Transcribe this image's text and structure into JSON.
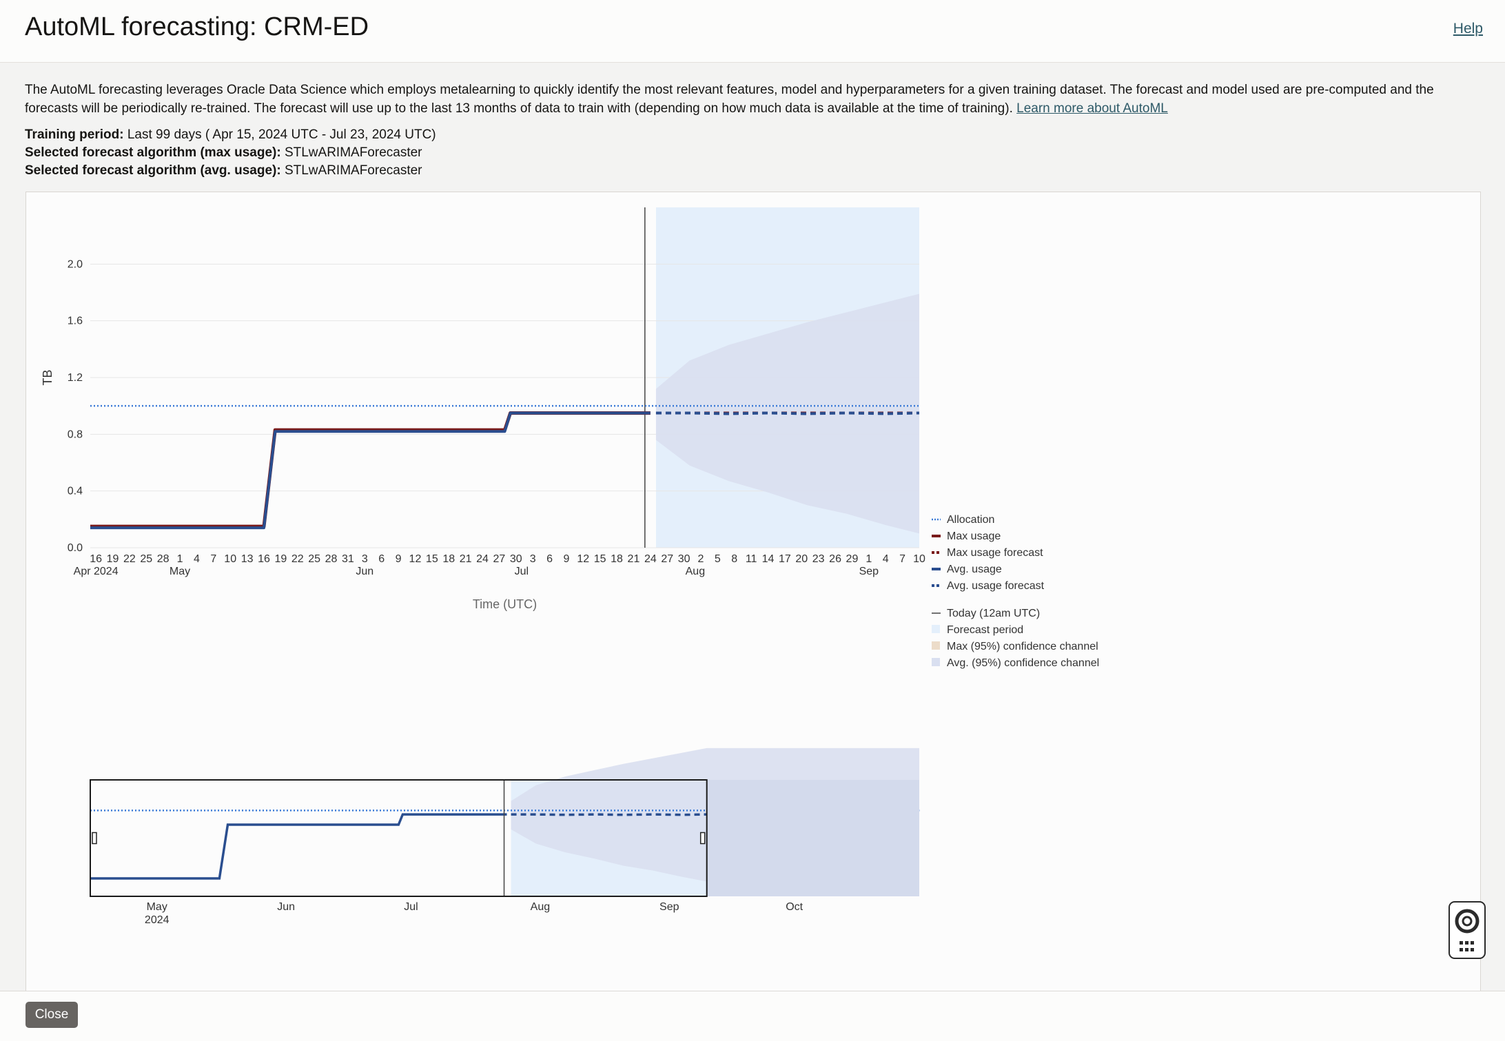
{
  "header": {
    "title": "AutoML forecasting: CRM-ED",
    "help_label": "Help"
  },
  "intro": {
    "description": "The AutoML forecasting leverages Oracle Data Science which employs metalearning to quickly identify the most relevant features, model and hyperparameters for a given training dataset. The forecast and model used are pre-computed and the forecasts will be periodically re-trained. The forecast will use up to the last 13 months of data to train with (depending on how much data is available at the time of training).",
    "learn_more": "Learn more about AutoML"
  },
  "details": {
    "training_label": "Training period:",
    "training_value": "Last 99 days ( Apr 15, 2024 UTC - Jul 23, 2024 UTC)",
    "max_algo_label": "Selected forecast algorithm (max usage):",
    "max_algo_value": "STLwARIMAForecaster",
    "avg_algo_label": "Selected forecast algorithm (avg. usage):",
    "avg_algo_value": "STLwARIMAForecaster"
  },
  "footer": {
    "close_label": "Close"
  },
  "colors": {
    "allocation": "#3a7ad6",
    "max_usage": "#7a1a1a",
    "avg_usage": "#2a4e8f",
    "forecast_period": "#e4effb",
    "max_confidence": "#ecdcc9",
    "avg_confidence": "#d9dff0",
    "today_line": "#444444",
    "navigator_selection": "#1a1a1a"
  },
  "chart_data": {
    "type": "line",
    "ylabel": "TB",
    "xlabel": "Time (UTC)",
    "ylim": [
      0,
      2.4
    ],
    "yticks": [
      "0.0",
      "0.4",
      "0.8",
      "1.2",
      "1.6",
      "2.0"
    ],
    "grid": true,
    "legend_position": "right",
    "x_tick_labels": [
      "16",
      "19",
      "22",
      "25",
      "28",
      "1",
      "4",
      "7",
      "10",
      "13",
      "16",
      "19",
      "22",
      "25",
      "28",
      "31",
      "3",
      "6",
      "9",
      "12",
      "15",
      "18",
      "21",
      "24",
      "27",
      "30",
      "3",
      "6",
      "9",
      "12",
      "15",
      "18",
      "21",
      "24",
      "27",
      "30",
      "2",
      "5",
      "8",
      "11",
      "14",
      "17",
      "20",
      "23",
      "26",
      "29",
      "1",
      "4",
      "7",
      "10"
    ],
    "x_tick_dates": [
      "2024-04-16",
      "2024-04-19",
      "2024-04-22",
      "2024-04-25",
      "2024-04-28",
      "2024-05-01",
      "2024-05-04",
      "2024-05-07",
      "2024-05-10",
      "2024-05-13",
      "2024-05-16",
      "2024-05-19",
      "2024-05-22",
      "2024-05-25",
      "2024-05-28",
      "2024-05-31",
      "2024-06-03",
      "2024-06-06",
      "2024-06-09",
      "2024-06-12",
      "2024-06-15",
      "2024-06-18",
      "2024-06-21",
      "2024-06-24",
      "2024-06-27",
      "2024-06-30",
      "2024-07-03",
      "2024-07-06",
      "2024-07-09",
      "2024-07-12",
      "2024-07-15",
      "2024-07-18",
      "2024-07-21",
      "2024-07-24",
      "2024-07-27",
      "2024-07-30",
      "2024-08-02",
      "2024-08-05",
      "2024-08-08",
      "2024-08-11",
      "2024-08-14",
      "2024-08-17",
      "2024-08-20",
      "2024-08-23",
      "2024-08-26",
      "2024-08-29",
      "2024-09-01",
      "2024-09-04",
      "2024-09-07",
      "2024-09-10"
    ],
    "month_labels": [
      {
        "date": "2024-04-16",
        "label": "Apr 2024"
      },
      {
        "date": "2024-05-01",
        "label": "May"
      },
      {
        "date": "2024-06-03",
        "label": "Jun"
      },
      {
        "date": "2024-07-01",
        "label": "Jul"
      },
      {
        "date": "2024-08-01",
        "label": "Aug"
      },
      {
        "date": "2024-09-01",
        "label": "Sep"
      }
    ],
    "x_range": [
      "2024-04-15",
      "2024-09-10"
    ],
    "today": "2024-07-24",
    "forecast_period": [
      "2024-07-25",
      "2024-09-10"
    ],
    "series": [
      {
        "name": "Allocation",
        "style": "dotted",
        "x": [
          "2024-04-15",
          "2024-09-10"
        ],
        "y": [
          1.0,
          1.0
        ]
      },
      {
        "name": "Max usage",
        "style": "solid",
        "x": [
          "2024-04-15",
          "2024-05-16",
          "2024-05-18",
          "2024-06-28",
          "2024-06-29",
          "2024-07-24"
        ],
        "y": [
          0.15,
          0.15,
          0.83,
          0.83,
          0.95,
          0.95
        ]
      },
      {
        "name": "Max usage forecast",
        "style": "dashed",
        "x": [
          "2024-07-25",
          "2024-09-10"
        ],
        "y": [
          0.95,
          0.95
        ]
      },
      {
        "name": "Avg. usage",
        "style": "solid",
        "x": [
          "2024-04-15",
          "2024-05-16",
          "2024-05-18",
          "2024-06-28",
          "2024-06-29",
          "2024-07-24"
        ],
        "y": [
          0.14,
          0.14,
          0.82,
          0.82,
          0.95,
          0.95
        ]
      },
      {
        "name": "Avg. usage forecast",
        "style": "dashed",
        "x": [
          "2024-07-25",
          "2024-07-31",
          "2024-08-07",
          "2024-08-14",
          "2024-08-21",
          "2024-08-28",
          "2024-09-04",
          "2024-09-10"
        ],
        "y": [
          0.95,
          0.95,
          0.945,
          0.95,
          0.945,
          0.95,
          0.945,
          0.95
        ]
      }
    ],
    "confidence_channel_avg": {
      "name": "Avg. (95%) confidence channel",
      "x": [
        "2024-07-25",
        "2024-07-31",
        "2024-08-07",
        "2024-08-14",
        "2024-08-21",
        "2024-08-28",
        "2024-09-04",
        "2024-09-10"
      ],
      "upper": [
        1.12,
        1.32,
        1.43,
        1.51,
        1.59,
        1.66,
        1.73,
        1.79
      ],
      "lower": [
        0.76,
        0.58,
        0.47,
        0.39,
        0.3,
        0.24,
        0.16,
        0.1
      ]
    },
    "legend": [
      "Allocation",
      "Max usage",
      "Max usage forecast",
      "Avg. usage",
      "Avg. usage forecast",
      "Today (12am UTC)",
      "Forecast period",
      "Max (95%) confidence channel",
      "Avg. (95%) confidence channel"
    ],
    "navigator": {
      "x_range": [
        "2024-04-15",
        "2024-10-31"
      ],
      "selected_range": [
        "2024-04-15",
        "2024-09-10"
      ],
      "month_labels": [
        {
          "date": "2024-05-01",
          "label": "May",
          "sub": "2024"
        },
        {
          "date": "2024-06-01",
          "label": "Jun",
          "sub": ""
        },
        {
          "date": "2024-07-01",
          "label": "Jul",
          "sub": ""
        },
        {
          "date": "2024-08-01",
          "label": "Aug",
          "sub": ""
        },
        {
          "date": "2024-09-01",
          "label": "Sep",
          "sub": ""
        },
        {
          "date": "2024-10-01",
          "label": "Oct",
          "sub": ""
        }
      ]
    }
  }
}
